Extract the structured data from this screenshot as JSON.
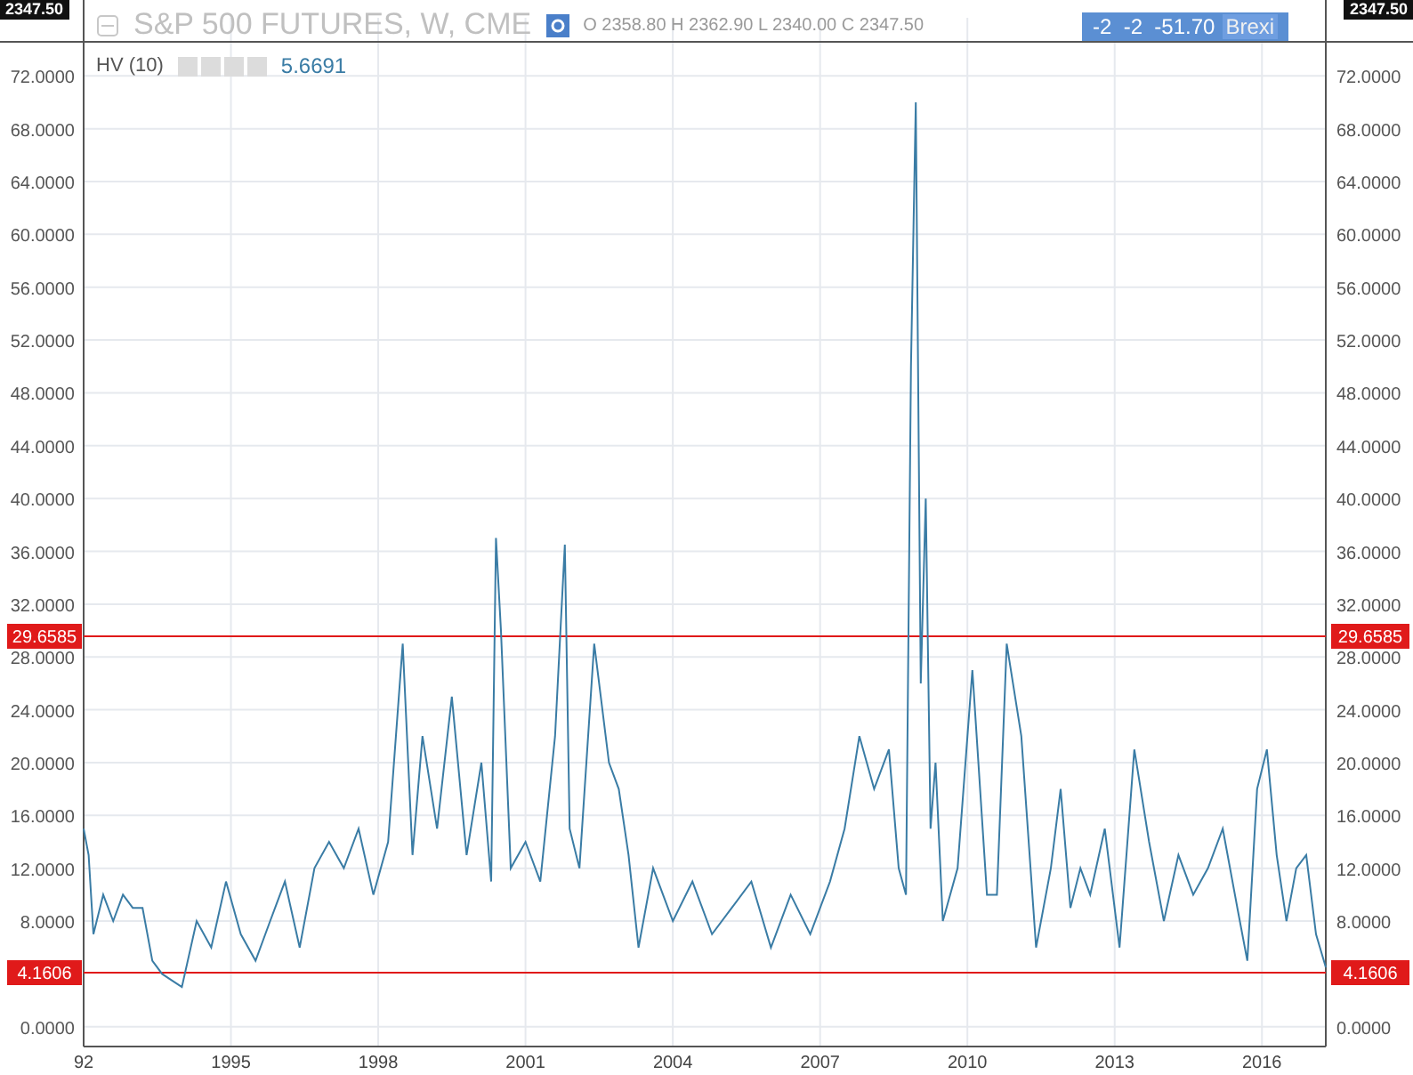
{
  "top_badges": [
    {
      "text": "2347.50"
    },
    {
      "text": "2347.50"
    }
  ],
  "legend": {
    "symbol": "S&P 500 FUTURES, W, CME",
    "ohlc": "O 2358.80 H 2362.90 L 2340.00 C 2347.50",
    "event_strip": "-2  -2  -51.70",
    "event_label": "Brexi"
  },
  "study": {
    "value": "5.6691"
  },
  "right_axis_badges": [
    "29.6585",
    "4.1606"
  ],
  "chart_data": {
    "type": "line",
    "grid": true,
    "xlim": [
      1992,
      2017.3
    ],
    "ylim": [
      -1.5,
      76.4
    ],
    "x": [
      1992,
      1992.1,
      1992.2,
      1992.4,
      1992.6,
      1992.8,
      1993,
      1993.2,
      1993.4,
      1993.6,
      1993.8,
      1994,
      1994.3,
      1994.6,
      1994.9,
      1995.2,
      1995.5,
      1995.8,
      1996.1,
      1996.4,
      1996.7,
      1997,
      1997.3,
      1997.6,
      1997.9,
      1998.2,
      1998.5,
      1998.7,
      1998.9,
      1999.2,
      1999.5,
      1999.8,
      2000.1,
      2000.3,
      2000.4,
      2000.5,
      2000.7,
      2001,
      2001.3,
      2001.6,
      2001.8,
      2001.9,
      2002.1,
      2002.4,
      2002.7,
      2002.9,
      2003.1,
      2003.3,
      2003.6,
      2004,
      2004.4,
      2004.8,
      2005.2,
      2005.6,
      2006,
      2006.4,
      2006.8,
      2007.2,
      2007.5,
      2007.8,
      2008.1,
      2008.4,
      2008.6,
      2008.75,
      2008.85,
      2008.95,
      2009.05,
      2009.15,
      2009.25,
      2009.35,
      2009.5,
      2009.8,
      2010.1,
      2010.4,
      2010.6,
      2010.8,
      2011.1,
      2011.4,
      2011.7,
      2011.9,
      2012.1,
      2012.3,
      2012.5,
      2012.8,
      2013.1,
      2013.4,
      2013.7,
      2014,
      2014.3,
      2014.6,
      2014.9,
      2015.2,
      2015.5,
      2015.7,
      2015.9,
      2016.1,
      2016.3,
      2016.5,
      2016.7,
      2016.9,
      2017.1,
      2017.3
    ],
    "series": [
      {
        "name": "29.6585",
        "color": "#e01a1a",
        "values": [
          29.6585,
          29.6585,
          29.6585,
          29.6585,
          29.6585,
          29.6585,
          29.6585,
          29.6585,
          29.6585,
          29.6585,
          29.6585,
          29.6585,
          29.6585,
          29.6585,
          29.6585,
          29.6585,
          29.6585,
          29.6585,
          29.6585,
          29.6585,
          29.6585,
          29.6585,
          29.6585,
          29.6585,
          29.6585,
          29.6585,
          29.6585,
          29.6585,
          29.6585,
          29.6585,
          29.6585,
          29.6585,
          29.6585,
          29.6585,
          29.6585,
          29.6585,
          29.6585,
          29.6585,
          29.6585,
          29.6585,
          29.6585,
          29.6585,
          29.6585,
          29.6585,
          29.6585,
          29.6585,
          29.6585,
          29.6585,
          29.6585,
          29.6585,
          29.6585,
          29.6585,
          29.6585,
          29.6585,
          29.6585,
          29.6585,
          29.6585,
          29.6585,
          29.6585,
          29.6585,
          29.6585,
          29.6585,
          29.6585,
          29.6585,
          29.6585,
          29.6585,
          29.6585,
          29.6585,
          29.6585,
          29.6585,
          29.6585,
          29.6585,
          29.6585,
          29.6585,
          29.6585,
          29.6585,
          29.6585,
          29.6585,
          29.6585,
          29.6585,
          29.6585,
          29.6585,
          29.6585,
          29.6585,
          29.6585,
          29.6585,
          29.6585,
          29.6585,
          29.6585,
          29.6585,
          29.6585,
          29.6585,
          29.6585,
          29.6585,
          29.6585,
          29.6585,
          29.6585,
          29.6585,
          29.6585,
          29.6585,
          29.6585,
          29.6585
        ]
      },
      {
        "name": "4.1606",
        "color": "#e01a1a",
        "values": [
          4.1606,
          4.1606,
          4.1606,
          4.1606,
          4.1606,
          4.1606,
          4.1606,
          4.1606,
          4.1606,
          4.1606,
          4.1606,
          4.1606,
          4.1606,
          4.1606,
          4.1606,
          4.1606,
          4.1606,
          4.1606,
          4.1606,
          4.1606,
          4.1606,
          4.1606,
          4.1606,
          4.1606,
          4.1606,
          4.1606,
          4.1606,
          4.1606,
          4.1606,
          4.1606,
          4.1606,
          4.1606,
          4.1606,
          4.1606,
          4.1606,
          4.1606,
          4.1606,
          4.1606,
          4.1606,
          4.1606,
          4.1606,
          4.1606,
          4.1606,
          4.1606,
          4.1606,
          4.1606,
          4.1606,
          4.1606,
          4.1606,
          4.1606,
          4.1606,
          4.1606,
          4.1606,
          4.1606,
          4.1606,
          4.1606,
          4.1606,
          4.1606,
          4.1606,
          4.1606,
          4.1606,
          4.1606,
          4.1606,
          4.1606,
          4.1606,
          4.1606,
          4.1606,
          4.1606,
          4.1606,
          4.1606,
          4.1606,
          4.1606,
          4.1606,
          4.1606,
          4.1606,
          4.1606,
          4.1606,
          4.1606,
          4.1606,
          4.1606,
          4.1606,
          4.1606,
          4.1606,
          4.1606,
          4.1606,
          4.1606,
          4.1606,
          4.1606,
          4.1606,
          4.1606,
          4.1606,
          4.1606,
          4.1606,
          4.1606,
          4.1606,
          4.1606,
          4.1606,
          4.1606,
          4.1606,
          4.1606,
          4.1606,
          4.1606
        ]
      },
      {
        "name": "HV (10)",
        "color": "#3a7ca5",
        "values": [
          15,
          13,
          7,
          10,
          8,
          10,
          9,
          9,
          5,
          4,
          3.5,
          3,
          8,
          6,
          11,
          7,
          5,
          8,
          11,
          6,
          12,
          14,
          12,
          15,
          10,
          14,
          29,
          13,
          22,
          15,
          25,
          13,
          20,
          11,
          37,
          30,
          12,
          14,
          11,
          22,
          36.5,
          15,
          12,
          29,
          20,
          18,
          13,
          6,
          12,
          8,
          11,
          7,
          9,
          11,
          6,
          10,
          7,
          11,
          15,
          22,
          18,
          21,
          12,
          10,
          50,
          70,
          26,
          40,
          15,
          20,
          8,
          12,
          27,
          10,
          10,
          29,
          22,
          6,
          12,
          18,
          9,
          12,
          10,
          15,
          6,
          21,
          14,
          8,
          13,
          10,
          12,
          15,
          9,
          5,
          18,
          21,
          13,
          8,
          12,
          13,
          7,
          4.5
        ]
      }
    ],
    "xticks": [
      {
        "value": 1992,
        "label": "92"
      },
      1995,
      1998,
      2001,
      2004,
      2007,
      2010,
      2013,
      2016
    ],
    "yticks": [
      {
        "value": 0,
        "label": "0.0000"
      },
      {
        "value": 8,
        "label": "8.0000"
      },
      {
        "value": 12,
        "label": "12.0000"
      },
      {
        "value": 16,
        "label": "16.0000"
      },
      {
        "value": 20,
        "label": "20.0000"
      },
      {
        "value": 24,
        "label": "24.0000"
      },
      {
        "value": 28,
        "label": "28.0000"
      },
      {
        "value": 32,
        "label": "32.0000"
      },
      {
        "value": 36,
        "label": "36.0000"
      },
      {
        "value": 40,
        "label": "40.0000"
      },
      {
        "value": 44,
        "label": "44.0000"
      },
      {
        "value": 48,
        "label": "48.0000"
      },
      {
        "value": 52,
        "label": "52.0000"
      },
      {
        "value": 56,
        "label": "56.0000"
      },
      {
        "value": 60,
        "label": "60.0000"
      },
      {
        "value": 64,
        "label": "64.0000"
      },
      {
        "value": 68,
        "label": "68.0000"
      },
      {
        "value": 72,
        "label": "72.0000"
      }
    ]
  }
}
